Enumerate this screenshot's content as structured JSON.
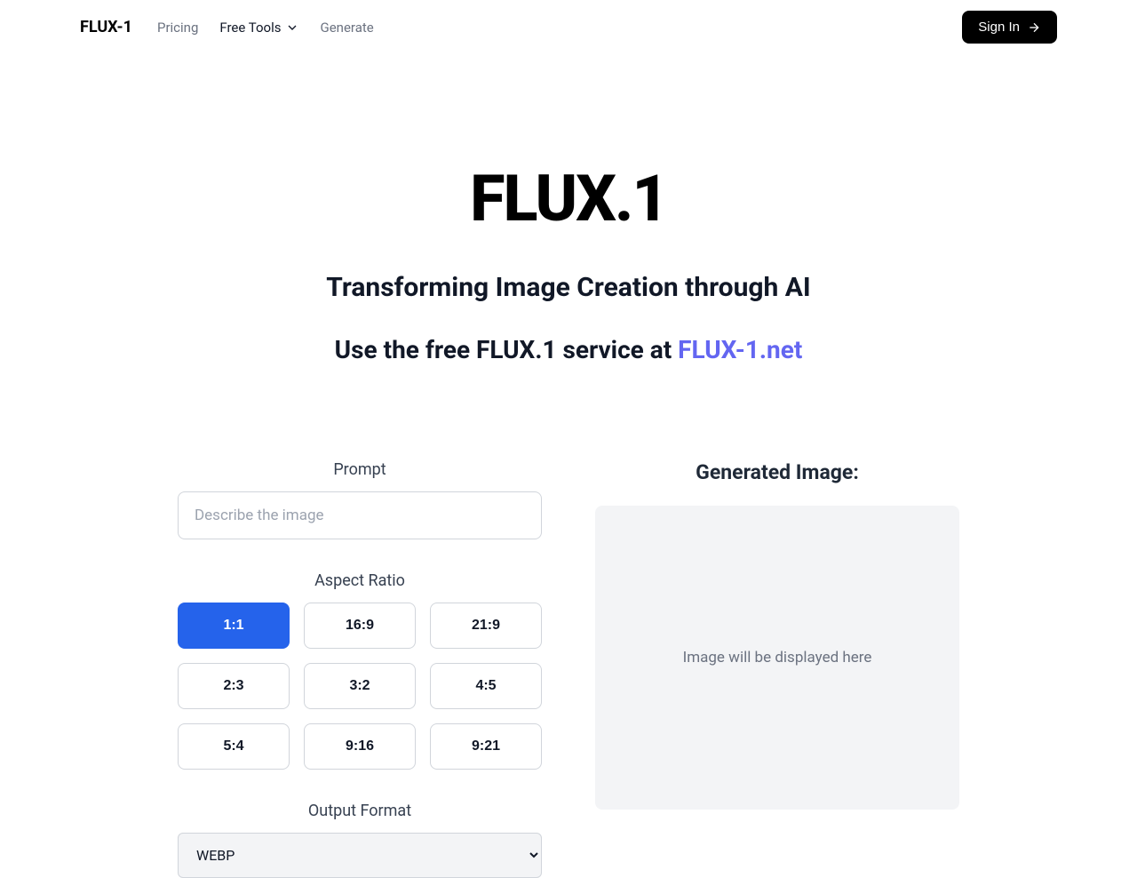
{
  "header": {
    "logo": "FLUX-1",
    "nav": {
      "pricing": "Pricing",
      "free_tools": "Free Tools",
      "generate": "Generate"
    },
    "sign_in": "Sign In"
  },
  "hero": {
    "title": "FLUX.1",
    "subtitle": "Transforming Image Creation through AI",
    "cta_prefix": "Use the free FLUX.1 service at ",
    "cta_link": "FLUX-1.net"
  },
  "form": {
    "prompt_label": "Prompt",
    "prompt_placeholder": "Describe the image",
    "aspect_label": "Aspect Ratio",
    "aspect_options": [
      "1:1",
      "16:9",
      "21:9",
      "2:3",
      "3:2",
      "4:5",
      "5:4",
      "9:16",
      "9:21"
    ],
    "aspect_selected": "1:1",
    "output_label": "Output Format",
    "output_selected": "WEBP"
  },
  "preview": {
    "title": "Generated Image:",
    "placeholder": "Image will be displayed here"
  }
}
